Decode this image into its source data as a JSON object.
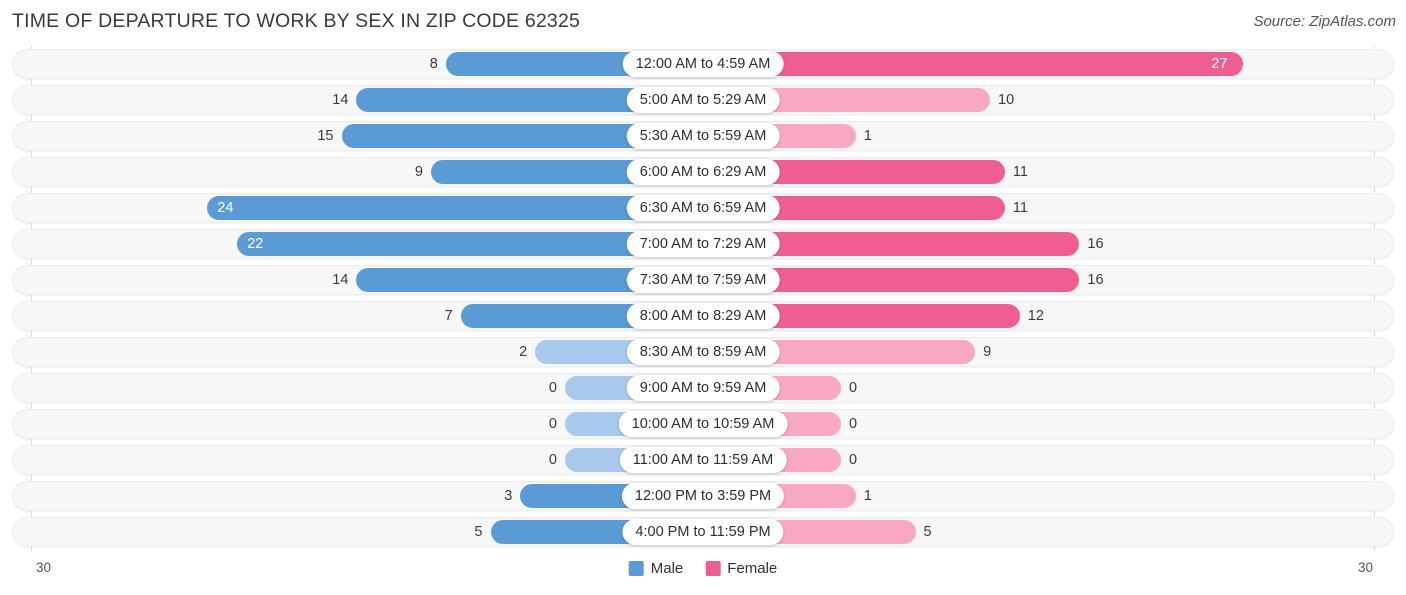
{
  "header": {
    "title": "TIME OF DEPARTURE TO WORK BY SEX IN ZIP CODE 62325",
    "source": "Source: ZipAtlas.com"
  },
  "legend": {
    "male_label": "Male",
    "female_label": "Female",
    "male_color": "#5b9bd5",
    "female_color": "#ef5e92"
  },
  "axis": {
    "left_tick": "30",
    "right_tick": "30",
    "max": 30
  },
  "colors": {
    "male_strong": "#5b9bd5",
    "male_light": "#a9c9ec",
    "female_strong": "#ef5e92",
    "female_light": "#f9a8c4",
    "track": "#f7f7f7"
  },
  "chart_data": {
    "type": "bar",
    "orientation": "horizontal-diverging",
    "title": "TIME OF DEPARTURE TO WORK BY SEX IN ZIP CODE 62325",
    "xlabel": "",
    "ylabel": "",
    "xlim": [
      30,
      30
    ],
    "grid": false,
    "legend_position": "bottom-center",
    "categories": [
      "12:00 AM to 4:59 AM",
      "5:00 AM to 5:29 AM",
      "5:30 AM to 5:59 AM",
      "6:00 AM to 6:29 AM",
      "6:30 AM to 6:59 AM",
      "7:00 AM to 7:29 AM",
      "7:30 AM to 7:59 AM",
      "8:00 AM to 8:29 AM",
      "8:30 AM to 8:59 AM",
      "9:00 AM to 9:59 AM",
      "10:00 AM to 10:59 AM",
      "11:00 AM to 11:59 AM",
      "12:00 PM to 3:59 PM",
      "4:00 PM to 11:59 PM"
    ],
    "series": [
      {
        "name": "Male",
        "values": [
          8,
          14,
          15,
          9,
          24,
          22,
          14,
          7,
          2,
          0,
          0,
          0,
          3,
          5
        ]
      },
      {
        "name": "Female",
        "values": [
          27,
          10,
          1,
          11,
          11,
          16,
          16,
          12,
          9,
          0,
          0,
          0,
          1,
          5
        ]
      }
    ]
  },
  "rows": [
    {
      "label": "12:00 AM to 4:59 AM",
      "male": "8",
      "female": "27",
      "male_val": 8,
      "female_val": 27
    },
    {
      "label": "5:00 AM to 5:29 AM",
      "male": "14",
      "female": "10",
      "male_val": 14,
      "female_val": 10
    },
    {
      "label": "5:30 AM to 5:59 AM",
      "male": "15",
      "female": "1",
      "male_val": 15,
      "female_val": 1
    },
    {
      "label": "6:00 AM to 6:29 AM",
      "male": "9",
      "female": "11",
      "male_val": 9,
      "female_val": 11
    },
    {
      "label": "6:30 AM to 6:59 AM",
      "male": "24",
      "female": "11",
      "male_val": 24,
      "female_val": 11
    },
    {
      "label": "7:00 AM to 7:29 AM",
      "male": "22",
      "female": "16",
      "male_val": 22,
      "female_val": 16
    },
    {
      "label": "7:30 AM to 7:59 AM",
      "male": "14",
      "female": "16",
      "male_val": 14,
      "female_val": 16
    },
    {
      "label": "8:00 AM to 8:29 AM",
      "male": "7",
      "female": "12",
      "male_val": 7,
      "female_val": 12
    },
    {
      "label": "8:30 AM to 8:59 AM",
      "male": "2",
      "female": "9",
      "male_val": 2,
      "female_val": 9
    },
    {
      "label": "9:00 AM to 9:59 AM",
      "male": "0",
      "female": "0",
      "male_val": 0,
      "female_val": 0
    },
    {
      "label": "10:00 AM to 10:59 AM",
      "male": "0",
      "female": "0",
      "male_val": 0,
      "female_val": 0
    },
    {
      "label": "11:00 AM to 11:59 AM",
      "male": "0",
      "female": "0",
      "male_val": 0,
      "female_val": 0
    },
    {
      "label": "12:00 PM to 3:59 PM",
      "male": "3",
      "female": "1",
      "male_val": 3,
      "female_val": 1
    },
    {
      "label": "4:00 PM to 11:59 PM",
      "male": "5",
      "female": "5",
      "male_val": 5,
      "female_val": 5
    }
  ]
}
